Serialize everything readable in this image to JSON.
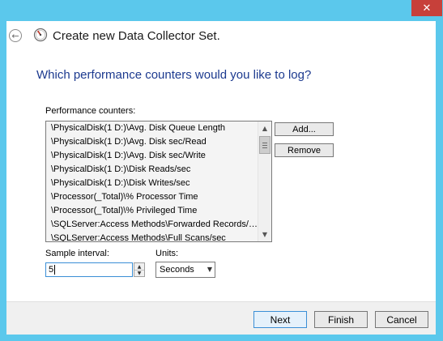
{
  "window": {
    "title": "Create new Data Collector Set.",
    "close_glyph": "✕",
    "back_glyph": "←"
  },
  "page": {
    "heading": "Which performance counters would you like to log?"
  },
  "counters": {
    "label": "Performance counters:",
    "items": [
      "\\PhysicalDisk(1 D:)\\Avg. Disk Queue Length",
      "\\PhysicalDisk(1 D:)\\Avg. Disk sec/Read",
      "\\PhysicalDisk(1 D:)\\Avg. Disk sec/Write",
      "\\PhysicalDisk(1 D:)\\Disk Reads/sec",
      "\\PhysicalDisk(1 D:)\\Disk Writes/sec",
      "\\Processor(_Total)\\% Processor Time",
      "\\Processor(_Total)\\% Privileged Time",
      "\\SQLServer:Access Methods\\Forwarded Records/sec",
      "\\SQLServer:Access Methods\\Full Scans/sec"
    ],
    "add_label": "Add...",
    "remove_label": "Remove"
  },
  "sample": {
    "interval_label": "Sample interval:",
    "interval_value": "5",
    "units_label": "Units:",
    "units_value": "Seconds"
  },
  "footer": {
    "next_label": "Next",
    "finish_label": "Finish",
    "cancel_label": "Cancel"
  },
  "colors": {
    "frame": "#5bc8ec",
    "heading": "#1c3a8f",
    "close_button": "#c7403a",
    "focus_border": "#3b8fd6"
  },
  "icons": {
    "back": "back-arrow-icon",
    "app": "performance-gauge-icon",
    "close": "close-icon",
    "scroll_up": "chevron-up-icon",
    "scroll_down": "chevron-down-icon",
    "dropdown": "chevron-down-icon"
  }
}
